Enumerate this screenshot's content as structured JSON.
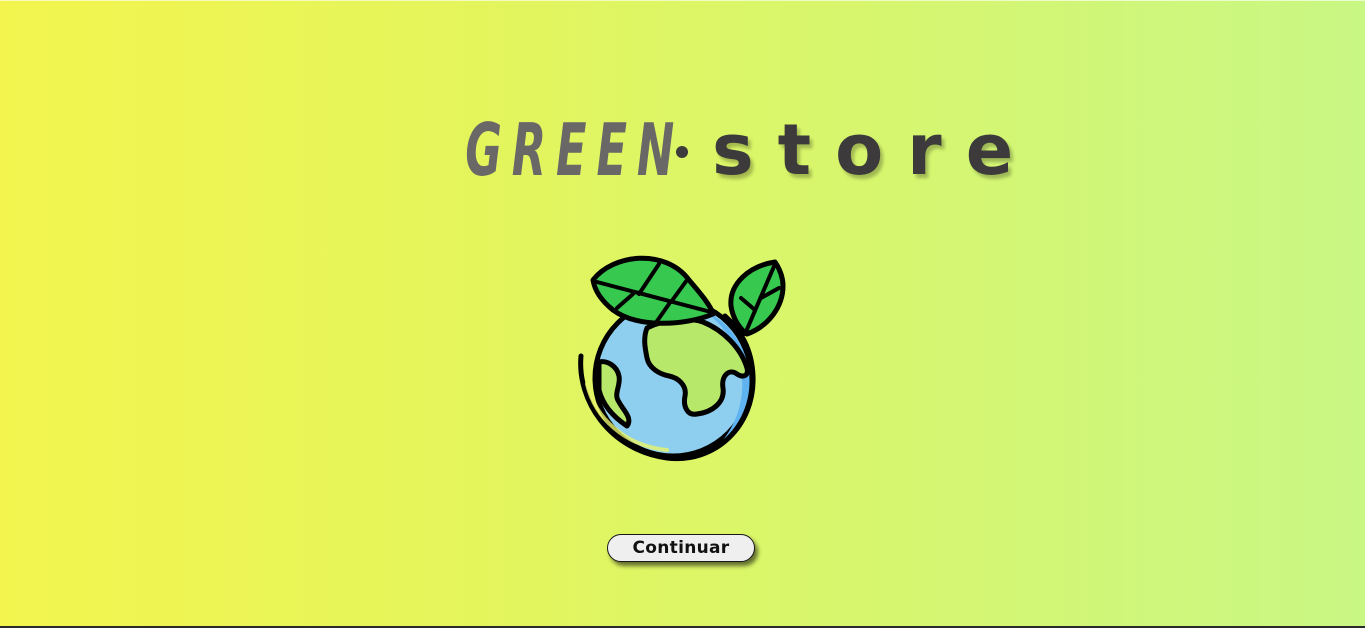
{
  "brand": {
    "word_green": "GREEN",
    "word_store": "store",
    "logo_icon": "earth-with-leaves-icon"
  },
  "actions": {
    "continue_label": "Continuar"
  },
  "colors": {
    "background_left": "#f3f54e",
    "background_right": "#c9f784",
    "green_text": "#6a6767",
    "store_text": "#3c3a3b",
    "leaf_green": "#37c84f",
    "globe_blue": "#8ecff0",
    "land_green": "#b8e86a"
  }
}
